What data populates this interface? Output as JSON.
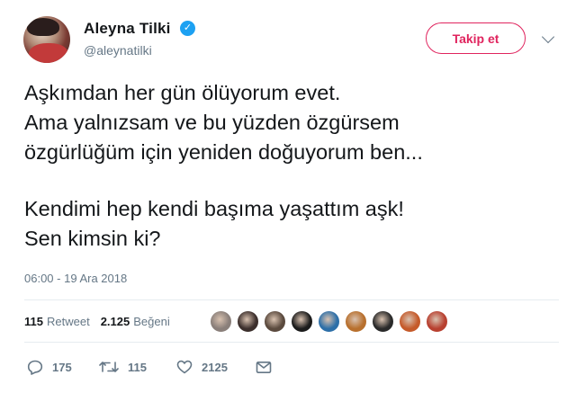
{
  "user": {
    "name": "Aleyna Tilki",
    "handle": "@aleynatilki",
    "verified_icon": "✓"
  },
  "follow_button": {
    "label": "Takip et"
  },
  "tweet": {
    "lines_1": [
      "Aşkımdan her gün ölüyorum evet.",
      "Ama yalnızsam ve bu yüzden özgürsem",
      "özgürlüğüm için yeniden doğuyorum ben..."
    ],
    "lines_2": [
      "Kendimi hep kendi başıma yaşattım aşk!",
      "Sen kimsin ki?"
    ],
    "timestamp": "06:00 - 19 Ara 2018"
  },
  "stats": {
    "retweets": "115",
    "retweets_label": "Retweet",
    "likes": "2.125",
    "likes_label": "Beğeni"
  },
  "liker_avatars": [
    {
      "color": "#8a7f7a"
    },
    {
      "color": "#3c2f2c"
    },
    {
      "color": "#5b4a3e"
    },
    {
      "color": "#1c1c1c"
    },
    {
      "color": "#2d6fa8"
    },
    {
      "color": "#b8702e"
    },
    {
      "color": "#2a2a2a"
    },
    {
      "color": "#c55a2a"
    },
    {
      "color": "#b84030"
    }
  ],
  "actions": {
    "reply_count": "175",
    "retweet_count": "115",
    "like_count": "2125"
  },
  "colors": {
    "accent": "#e0245e",
    "verified": "#1da1f2",
    "muted": "#657786",
    "text": "#14171a"
  }
}
